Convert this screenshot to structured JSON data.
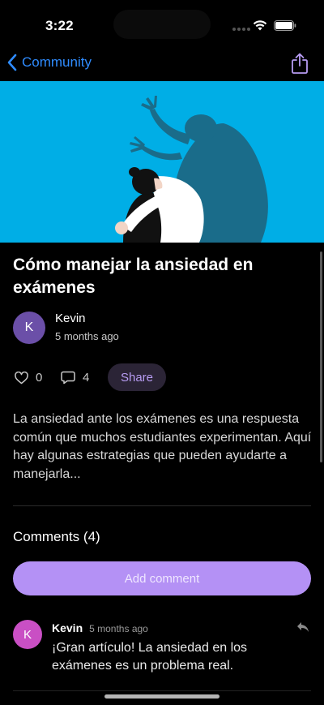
{
  "status_bar": {
    "time": "3:22"
  },
  "nav": {
    "back_label": "Community",
    "back_icon": "chevron-left-icon",
    "share_icon": "share-icon",
    "accent": "#2f8cff"
  },
  "hero": {
    "background": "#00aee6",
    "image": "anxious-person-with-shadow-monster-illustration"
  },
  "article": {
    "title": "Cómo manejar la ansiedad en exámenes",
    "author": {
      "initial": "K",
      "name": "Kevin",
      "time": "5 months ago"
    },
    "likes": "0",
    "comments_count": "4",
    "share_label": "Share",
    "body": "La ansiedad ante los exámenes es una respuesta común que muchos estudiantes experimentan. Aquí hay algunas estrategias que pueden ayudarte a manejarla..."
  },
  "comments": {
    "heading": "Comments (4)",
    "add_label": "Add comment",
    "items": [
      {
        "initial": "K",
        "author": "Kevin",
        "time": "5 months ago",
        "text": "¡Gran artículo! La ansiedad en los exámenes es un problema real."
      }
    ]
  },
  "colors": {
    "primary_purple": "#b491f5",
    "share_text": "#b79cf2"
  }
}
